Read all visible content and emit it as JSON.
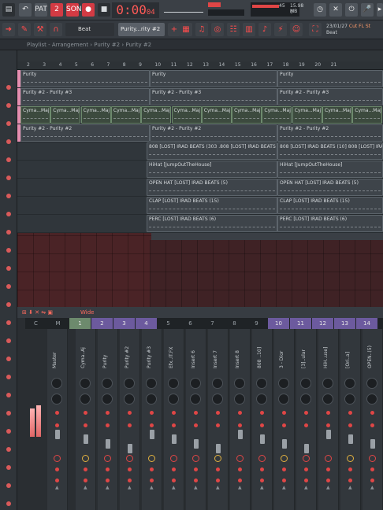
{
  "toolbar": {
    "pat_label": "PAT",
    "song_label": "SONG",
    "time": "0:00",
    "time_sub": "04",
    "tempo_value": "45",
    "memory": "15.98 MB",
    "memory_sub": "0",
    "cpu_label": "14",
    "hint_main": "Cut FL St",
    "hint_sub": "Beat",
    "hint_date": "23/01/27",
    "pattern_name": "Purity...rity #2",
    "beat_label": "Beat"
  },
  "breadcrumb": "Playlist - Arrangement › Purity #2 › Purity #2",
  "ruler_numbers": [
    "2",
    "3",
    "4",
    "5",
    "6",
    "7",
    "8",
    "9",
    "10",
    "11",
    "12",
    "13",
    "14",
    "15",
    "16",
    "17",
    "18",
    "19",
    "20",
    "21"
  ],
  "tracks": [
    {
      "clips": [
        "Purity",
        "Purity",
        "Purity"
      ]
    },
    {
      "clips": [
        "Purity #2 - Purity #3",
        "Purity #2 - Purity #3",
        "Purity #2 - Purity #3"
      ]
    },
    {
      "clips": [
        "Cyma...Maj",
        "Cyma...Maj",
        "Cyma...Maj",
        "Cyma...Maj",
        "Cyma...Maj",
        "Cyma...Maj",
        "Cyma...Maj",
        "Cyma...Maj",
        "Cyma...Maj",
        "Cyma...Maj",
        "Cyma...Maj",
        "Cyma...Maj"
      ]
    },
    {
      "clips": [
        "Purity #2 - Purity #2",
        "Purity #2 - Purity #2",
        "Purity #2 - Purity #2"
      ]
    },
    {
      "clips": [
        "808 [LOST] IRAD BEATS (303 .808 [LOST] IRAD BEATS (10]",
        "808 [LOST] IRAD BEATS (10] 808 [LOST] IRAD BEATS (10]"
      ]
    },
    {
      "clips": [
        "HiHat [JumpOutTheHouse]",
        "HiHat [JumpOutTheHouse]"
      ]
    },
    {
      "clips": [
        "OPEN HAT [LOST] IRAD BEATS (5)",
        "OPEN HAT [LOST] IRAD BEATS (5)"
      ]
    },
    {
      "clips": [
        "CLAP [LOST] IRAD BEATS (15)",
        "CLAP [LOST] IRAD BEATS (15)"
      ]
    },
    {
      "clips": [
        "PERC [LOST] IRAD BEATS (6)",
        "PERC [LOST] IRAD BEATS (6)"
      ]
    }
  ],
  "mixer": {
    "header_label": "Wide",
    "column_labels": [
      "C",
      "M",
      "1",
      "2",
      "3",
      "4",
      "5",
      "6",
      "7",
      "8",
      "9",
      "10",
      "11",
      "12",
      "13",
      "14"
    ],
    "strips": [
      "Master",
      "Cyma..Aj",
      "Purity",
      "Purity #2",
      "Purity #3",
      "Efx..IT.FX",
      "Insert 6",
      "Insert 7",
      "Insert 8",
      "808 ..10]",
      "3 - Dior",
      "[3]..ular",
      "HiH..use]",
      "[Ori..a]",
      "OPEN..(5)"
    ]
  },
  "colors": {
    "accent_red": "#d33b44",
    "purple_header": "#6c5a9e",
    "clip_pink": "#e58eb0"
  }
}
